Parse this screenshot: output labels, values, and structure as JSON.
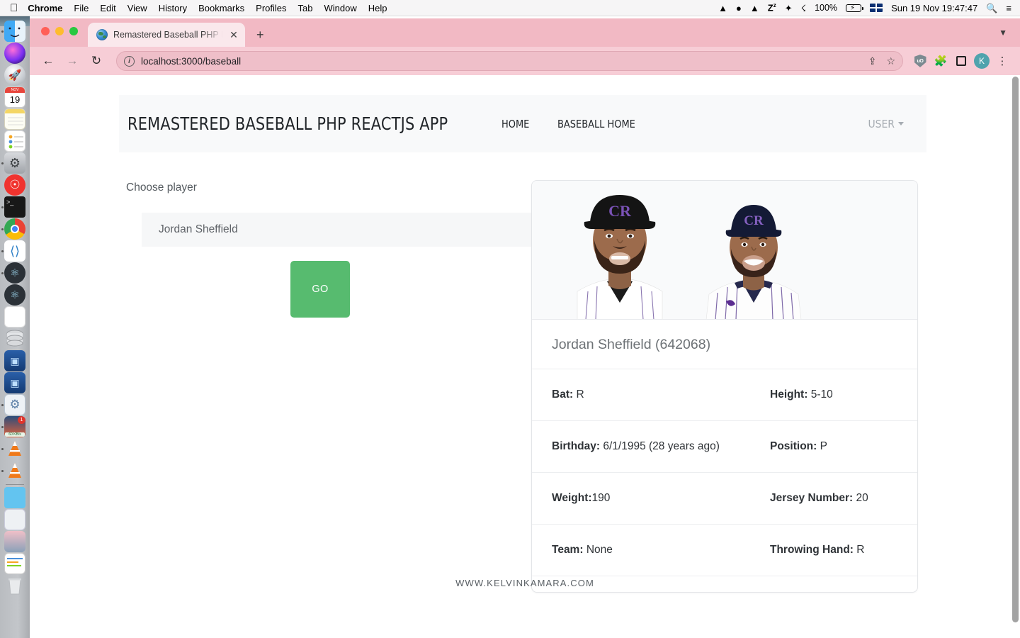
{
  "os_menubar": {
    "apple_icon": "apple-icon",
    "items": [
      {
        "label": "Chrome",
        "bold": true
      },
      {
        "label": "File",
        "bold": false
      },
      {
        "label": "Edit",
        "bold": false
      },
      {
        "label": "View",
        "bold": false
      },
      {
        "label": "History",
        "bold": false
      },
      {
        "label": "Bookmarks",
        "bold": false
      },
      {
        "label": "Profiles",
        "bold": false
      },
      {
        "label": "Tab",
        "bold": false
      },
      {
        "label": "Window",
        "bold": false
      },
      {
        "label": "Help",
        "bold": false
      }
    ],
    "status_icons": [
      "vlc-cone-icon",
      "docker-icon",
      "vlc-cone-icon",
      "amphetamine-zz-icon",
      "cleaner-rocket-icon",
      "wifi-icon"
    ],
    "battery_percent": "100%",
    "input_language": "uk-flag-icon",
    "datetime": "Sun 19 Nov  19:47:47",
    "search_icon": "spotlight-search-icon",
    "control_center_icon": "control-center-icon"
  },
  "dock": {
    "items": [
      {
        "name": "finder",
        "running": true
      },
      {
        "name": "siri",
        "running": false
      },
      {
        "name": "launchpad",
        "running": false
      },
      {
        "name": "calendar",
        "running": false,
        "badge": "19",
        "badge_month": "NOV"
      },
      {
        "name": "notes",
        "running": false
      },
      {
        "name": "reminders",
        "running": false
      },
      {
        "name": "system-settings",
        "running": true
      },
      {
        "name": "zoom",
        "running": false
      },
      {
        "name": "terminal",
        "running": true
      },
      {
        "name": "google-chrome",
        "running": true
      },
      {
        "name": "visual-studio-code",
        "running": true
      },
      {
        "name": "electron-app",
        "running": true
      },
      {
        "name": "electron-app-2",
        "running": false
      },
      {
        "name": "squirrel-app",
        "running": false
      },
      {
        "name": "database",
        "running": false
      },
      {
        "name": "virtualbox",
        "running": false
      },
      {
        "name": "virtualbox-2",
        "running": false
      },
      {
        "name": "settings-app",
        "running": true
      },
      {
        "name": "download-manager",
        "running": true,
        "badge": "1",
        "speed": "60 KB/s"
      },
      {
        "name": "vlc-media-player",
        "running": true
      },
      {
        "name": "vlc-media-player-2",
        "running": true
      },
      {
        "name": "downloads-folder",
        "running": false
      },
      {
        "name": "stack-window",
        "running": false
      },
      {
        "name": "stack-photo",
        "running": false
      },
      {
        "name": "stack-doc",
        "running": false
      },
      {
        "name": "trash",
        "running": false
      }
    ]
  },
  "browser": {
    "window_controls": [
      "close",
      "minimize",
      "maximize"
    ],
    "tab": {
      "title": "Remastered Baseball PHP Reac",
      "favicon": "globe-icon",
      "close_icon": "close-icon"
    },
    "new_tab_icon": "plus-icon",
    "tab_list_icon": "chevron-down-icon",
    "back_icon": "arrow-left-icon",
    "forward_icon": "arrow-right-icon",
    "reload_icon": "reload-icon",
    "site_info_icon": "info-icon",
    "url": "localhost:3000/baseball",
    "share_icon": "share-icon",
    "bookmark_icon": "star-icon",
    "extensions": [
      "ublock-origin-icon",
      "extensions-puzzle-icon",
      "side-panel-icon"
    ],
    "profile_initial": "K",
    "menu_icon": "three-dot-menu-icon"
  },
  "app": {
    "brand": "REMASTERED BASEBALL PHP REACTJS APP",
    "nav_links": [
      {
        "label": "HOME"
      },
      {
        "label": "BASEBALL HOME"
      }
    ],
    "user_menu": {
      "label": "USER",
      "caret_icon": "caret-down-icon"
    },
    "form": {
      "choose_label": "Choose player",
      "selected_player": "Jordan Sheffield",
      "go_button": "GO",
      "go_button_color": "#57bb6f"
    },
    "player_card": {
      "photos_alt": [
        "player-headshot-cap",
        "player-headshot-uniform"
      ],
      "team_colors": {
        "cap": "#1a1a2e",
        "logo_purple": "#33006f"
      },
      "name": "Jordan Sheffield",
      "id": "(642068)",
      "rows": [
        {
          "left": {
            "label": "Bat:",
            "value": "R"
          },
          "right": {
            "label": "Height:",
            "value": "5-10"
          }
        },
        {
          "left": {
            "label": "Birthday:",
            "value": "6/1/1995  (28 years ago)"
          },
          "right": {
            "label": "Position:",
            "value": "P"
          }
        },
        {
          "left": {
            "label": "Weight:",
            "value": "190"
          },
          "right": {
            "label": "Jersey Number:",
            "value": "20"
          }
        },
        {
          "left": {
            "label": "Team:",
            "value": "None"
          },
          "right": {
            "label": "Throwing Hand:",
            "value": "R"
          }
        }
      ]
    },
    "footer": "WWW.KELVINKAMARA.COM"
  }
}
